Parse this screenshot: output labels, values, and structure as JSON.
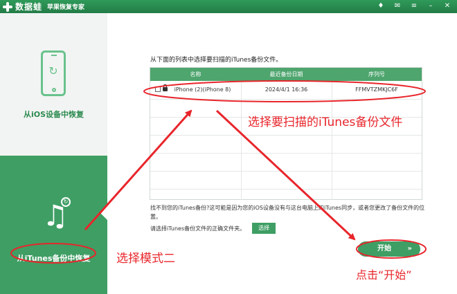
{
  "app": {
    "name": "数据蛙",
    "subtitle": "苹果恢复专家",
    "window_controls": [
      "gem-icon",
      "mail-icon",
      "menu-icon",
      "minimize-icon",
      "close-icon"
    ]
  },
  "sidebar": {
    "modes": [
      {
        "label": "从iOS设备中恢复",
        "active": false,
        "icon": "phone-restore-icon"
      },
      {
        "label": "从iTunes备份中恢复",
        "active": true,
        "icon": "music-note-icon"
      }
    ]
  },
  "main": {
    "instruction": "从下面的列表中选择要扫描的iTunes备份文件。",
    "table": {
      "headers": [
        "名称",
        "最近备份日期",
        "序列号"
      ],
      "rows": [
        {
          "name": "iPhone (2)(iPhone 8)",
          "date": "2024/4/1 16:36",
          "serial": "FFMVTZMKJC6F",
          "locked": true
        }
      ]
    },
    "help_text": "找不到您的iTunes备份?这可能是因为您的iOS设备没有与这台电脑上的iTunes同步，或者您更改了备份文件的位置。",
    "choose_label": "请选择iTunes备份文件的正确文件夹。",
    "choose_button": "选择",
    "start_button": "开始",
    "start_chevron": "»"
  },
  "annotations": {
    "color": "#e8252b",
    "select_text": "选择要扫描的iTunes备份文件",
    "mode_text": "选择模式二",
    "start_text": "点击“开始”"
  },
  "colors": {
    "titlebar": "#237c47",
    "accent": "#3f9e64",
    "table_header": "#4ea56e"
  }
}
